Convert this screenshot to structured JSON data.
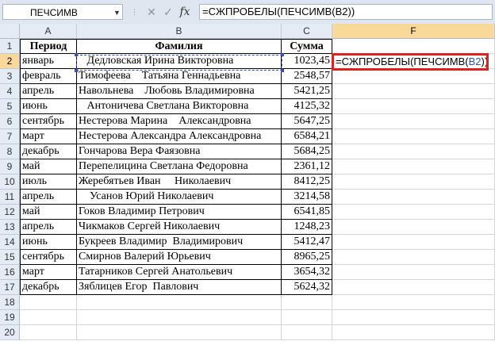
{
  "formula_bar": {
    "name_box": "ПЕЧСИМВ",
    "fx_label": "fx",
    "formula": "=СЖПРОБЕЛЫ(ПЕЧСИМВ(B2))"
  },
  "columns": [
    "A",
    "B",
    "C",
    "F"
  ],
  "row_numbers": [
    "1",
    "2",
    "3",
    "4",
    "5",
    "6",
    "7",
    "8",
    "9",
    "10",
    "11",
    "12",
    "13",
    "14",
    "15",
    "16",
    "17",
    "18",
    "19",
    "20"
  ],
  "table": {
    "headers": [
      "Период",
      "Фамилия",
      "Сумма"
    ],
    "rows": [
      [
        "январь",
        "   Дедловская Ирина Викторовна",
        "1023,45"
      ],
      [
        "февраль",
        "Тимофеева    Татьяна Геннадьевна",
        "2548,57"
      ],
      [
        "апрель",
        "Навольнева    Любовь Владимировна",
        "5421,25"
      ],
      [
        "июнь",
        "   Антоничева Светлана Викторовна",
        "4125,32"
      ],
      [
        "сентябрь",
        "Нестерова Марина    Александровна",
        "5647,25"
      ],
      [
        "март",
        "Нестерова Александра Александровна",
        "6584,21"
      ],
      [
        "декабрь",
        "Гончарова Вера Фаязовна",
        "5684,25"
      ],
      [
        "май",
        "Перепелицина Светлана Федоровна",
        "2361,12"
      ],
      [
        "июль",
        "Жеребятьев Иван     Николаевич",
        "8412,25"
      ],
      [
        "апрель",
        "    Усанов Юрий Николаевич",
        "3214,58"
      ],
      [
        "май",
        "Гоков Владимир Петрович",
        "6541,85"
      ],
      [
        "апрель",
        "Чикмаков Сергей Николаевич",
        "1248,23"
      ],
      [
        "июнь",
        "Букреев Владимир  Владимирович",
        "5412,47"
      ],
      [
        "сентябрь",
        "Смирнов Валерий Юрьевич",
        "8965,25"
      ],
      [
        "март",
        "Татарников Сергей Анатольевич",
        "3654,32"
      ],
      [
        "декабрь",
        "Зяблицев Егор  Павлович",
        "5624,32"
      ]
    ]
  },
  "editing_cell": {
    "prefix": "=СЖПРОБЕЛЫ(ПЕЧСИМВ(",
    "ref": "B2",
    "suffix": "))"
  }
}
